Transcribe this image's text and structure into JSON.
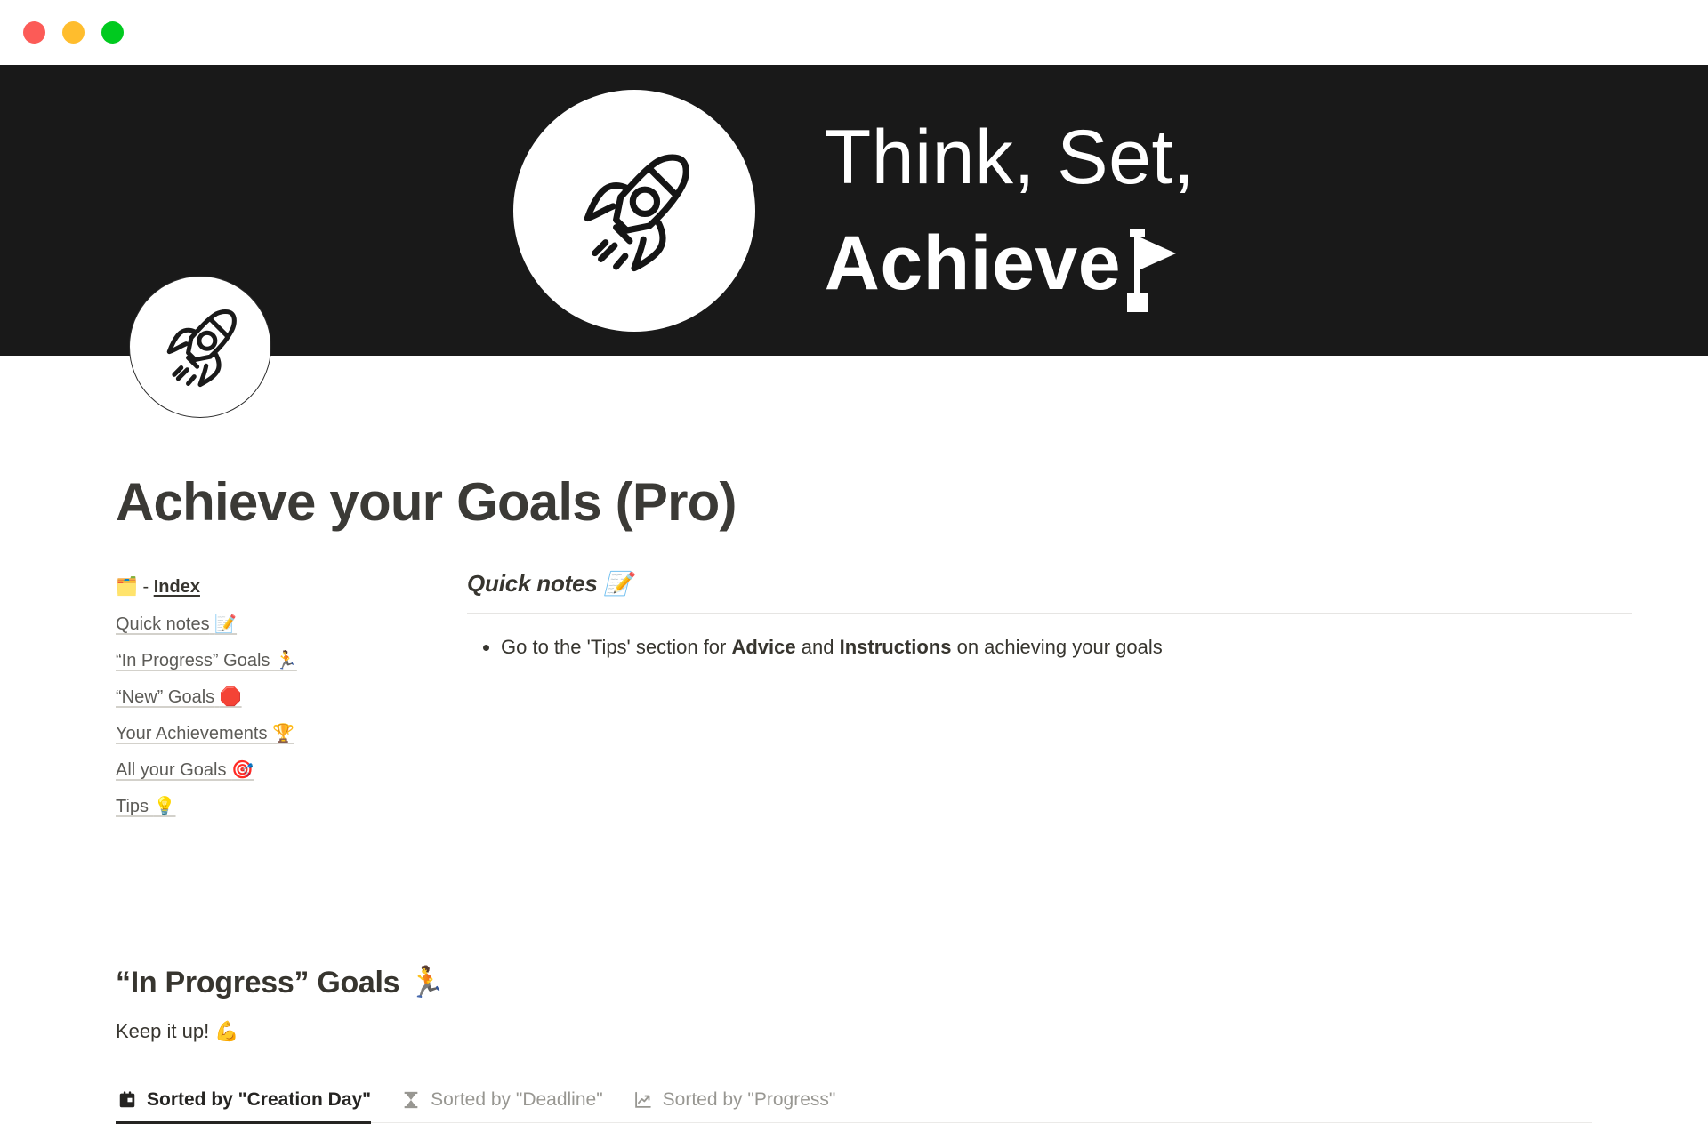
{
  "window": {
    "controls": [
      {
        "name": "close",
        "color": "#fc5b57"
      },
      {
        "name": "minimize",
        "color": "#ffbd2d"
      },
      {
        "name": "maximize",
        "color": "#00ca1f"
      }
    ]
  },
  "cover": {
    "background_color": "#191919",
    "logo_icon": "rocket-icon",
    "wordmark_line1": "Think, Set,",
    "wordmark_line2": "Achieve",
    "wordmark_exclaim_icon": "flag-icon"
  },
  "page": {
    "icon": "rocket-icon",
    "title": "Achieve your Goals (Pro)"
  },
  "index": {
    "emoji": "🗂️",
    "separator": "-",
    "label": "Index",
    "items": [
      {
        "label": "Quick notes",
        "emoji": "📝"
      },
      {
        "label": "“In Progress” Goals",
        "emoji": "🏃"
      },
      {
        "label": "“New” Goals",
        "emoji": "🛑"
      },
      {
        "label": "Your Achievements",
        "emoji": "🏆"
      },
      {
        "label": "All your Goals",
        "emoji": "🎯"
      },
      {
        "label": "Tips",
        "emoji": "💡"
      }
    ]
  },
  "quick_notes": {
    "title": "Quick notes",
    "title_emoji": "📝",
    "bullets": [
      {
        "part1": "Go to the 'Tips' section for ",
        "bold1": "Advice",
        "part2": " and ",
        "bold2": "Instructions",
        "part3": " on achieving your goals"
      }
    ]
  },
  "in_progress": {
    "title": "“In Progress” Goals",
    "title_emoji": "🏃",
    "subtitle": "Keep it up!",
    "subtitle_emoji": "💪",
    "tabs": [
      {
        "label": "Sorted by \"Creation Day\"",
        "icon": "calendar-icon",
        "active": true
      },
      {
        "label": "Sorted by \"Deadline\"",
        "icon": "hourglass-icon",
        "active": false
      },
      {
        "label": "Sorted by \"Progress\"",
        "icon": "trend-chart-icon",
        "active": false
      }
    ]
  }
}
